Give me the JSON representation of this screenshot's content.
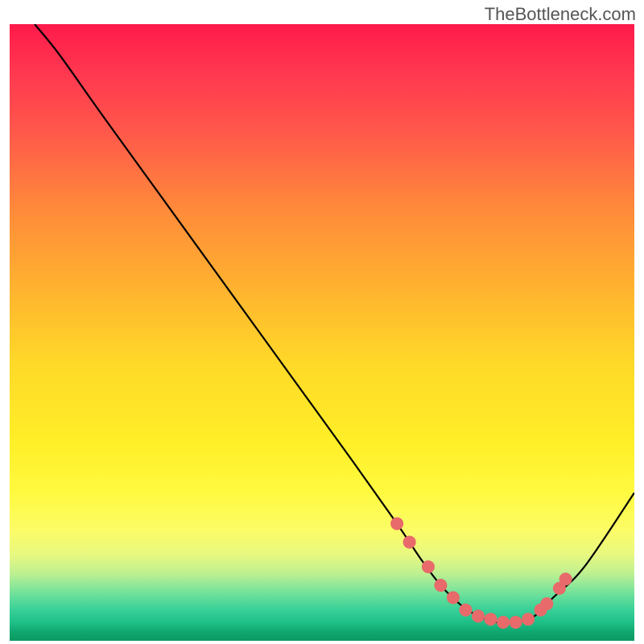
{
  "watermark": "TheBottleneck.com",
  "chart_data": {
    "type": "line",
    "title": "",
    "xlabel": "",
    "ylabel": "",
    "xlim": [
      0,
      100
    ],
    "ylim": [
      0,
      100
    ],
    "x": [
      4,
      8,
      15,
      25,
      35,
      45,
      55,
      62,
      66,
      69,
      72,
      75,
      78,
      81,
      84,
      87,
      92,
      100
    ],
    "values": [
      100,
      95,
      85,
      71,
      57,
      43,
      29,
      19,
      13,
      9,
      6,
      4,
      3,
      3,
      4,
      7,
      12,
      24
    ],
    "marker_points_x": [
      62,
      64,
      67,
      69,
      71,
      73,
      75,
      77,
      79,
      81,
      83,
      85,
      86,
      88,
      89
    ],
    "marker_points_y": [
      19,
      16,
      12,
      9,
      7,
      5,
      4,
      3.5,
      3,
      3,
      3.5,
      5,
      6,
      8.5,
      10
    ],
    "gradient_stops": [
      {
        "pos": 0,
        "color": "#ff1a4a"
      },
      {
        "pos": 50,
        "color": "#ffd928"
      },
      {
        "pos": 85,
        "color": "#fcfc66"
      },
      {
        "pos": 100,
        "color": "#0a9860"
      }
    ]
  }
}
